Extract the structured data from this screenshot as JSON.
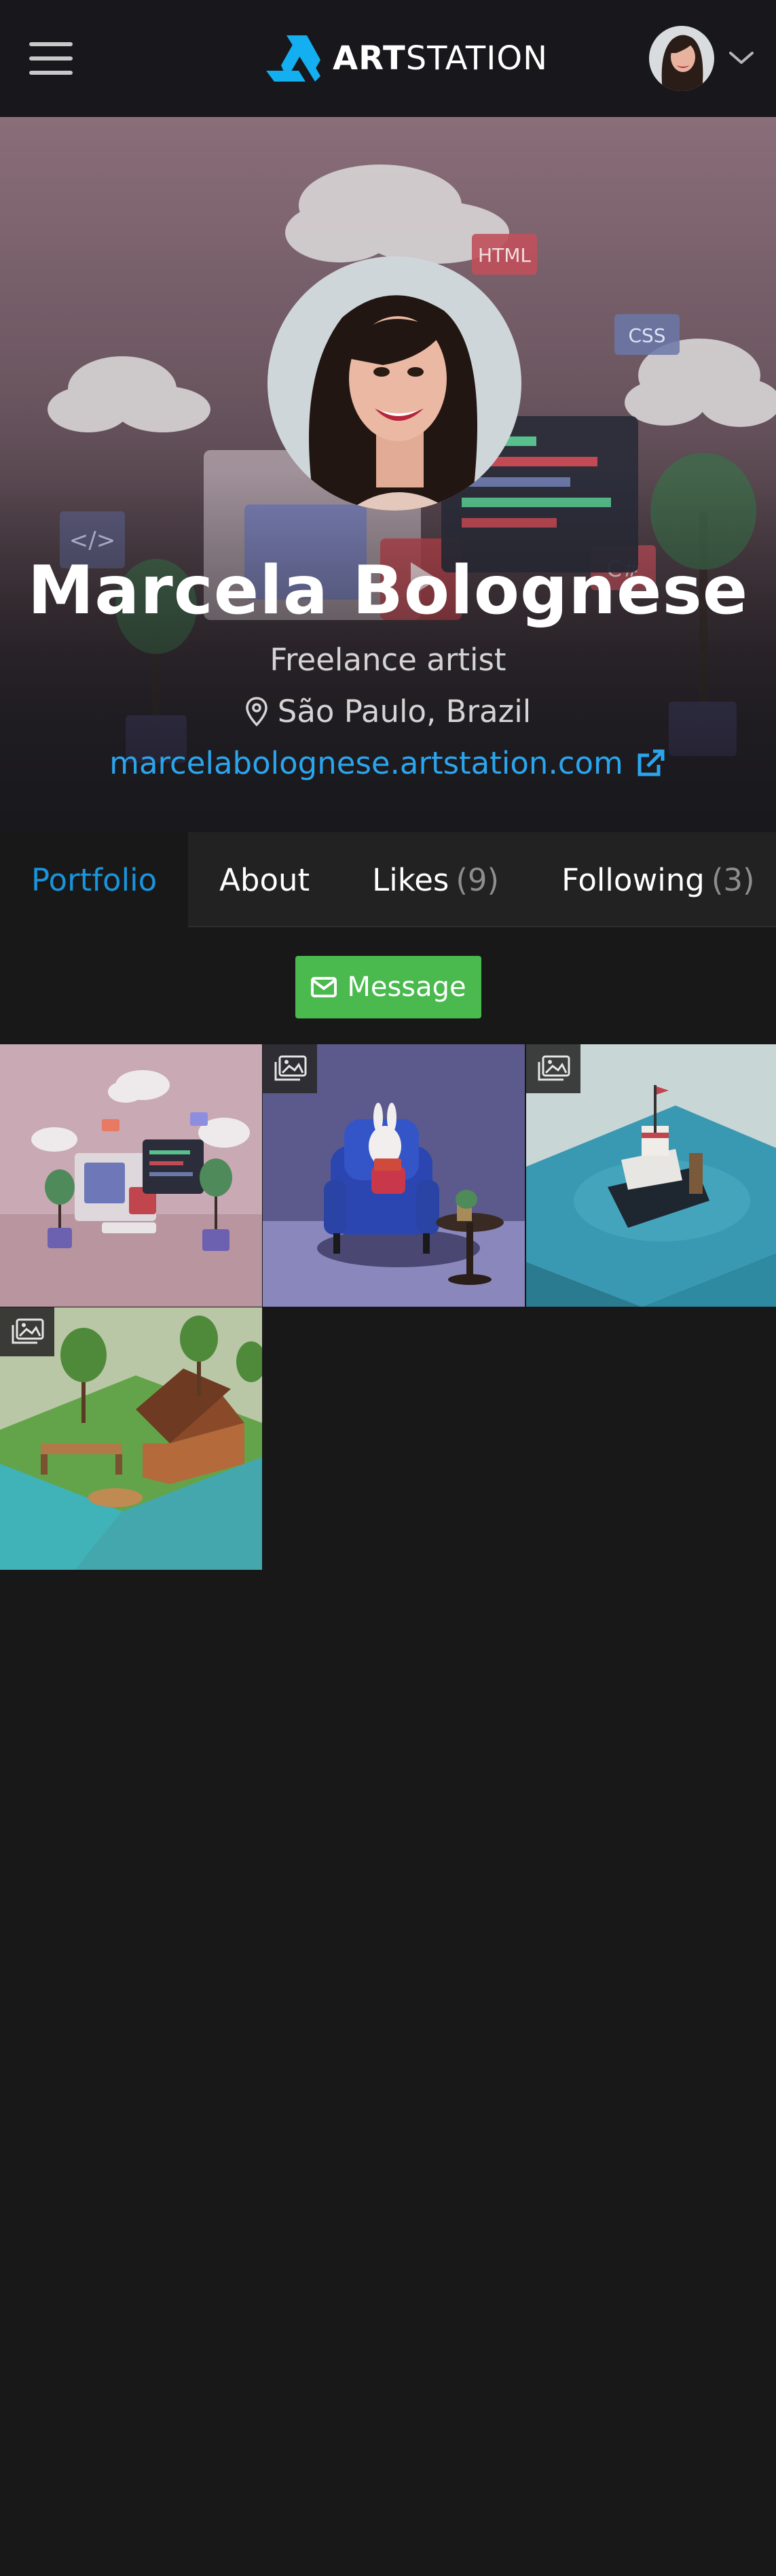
{
  "header": {
    "menu_icon": "hamburger-icon",
    "logo": {
      "bold": "ART",
      "regular": "STATION"
    },
    "user_menu_icon": "chevron-down-icon"
  },
  "profile": {
    "name": "Marcela Bolognese",
    "headline": "Freelance artist",
    "location": "São Paulo, Brazil",
    "location_icon": "map-pin-icon",
    "website": "marcelabolognese.artstation.com",
    "website_icon": "external-link-icon",
    "hero_labels": [
      "HTML",
      "CSS",
      "C#",
      "</>"
    ]
  },
  "tabs": [
    {
      "label": "Portfolio",
      "count": "",
      "active": true
    },
    {
      "label": "About",
      "count": "",
      "active": false
    },
    {
      "label": "Likes",
      "count": "(9)",
      "active": false
    },
    {
      "label": "Following",
      "count": "(3)",
      "active": false
    }
  ],
  "message_button": {
    "label": "Message",
    "icon": "envelope-icon"
  },
  "portfolio": {
    "items": [
      {
        "subject": "computer workspace with clouds",
        "multi_image": false
      },
      {
        "subject": "armchair with bunny reading",
        "multi_image": true
      },
      {
        "subject": "boat on water",
        "multi_image": true
      },
      {
        "subject": "cabin by the lake",
        "multi_image": true
      }
    ],
    "badge_icon": "image-gallery-icon"
  },
  "colors": {
    "accent": "#1a94dc",
    "link": "#2aa6ee",
    "message_button": "#4ab94e",
    "background": "#181818"
  }
}
